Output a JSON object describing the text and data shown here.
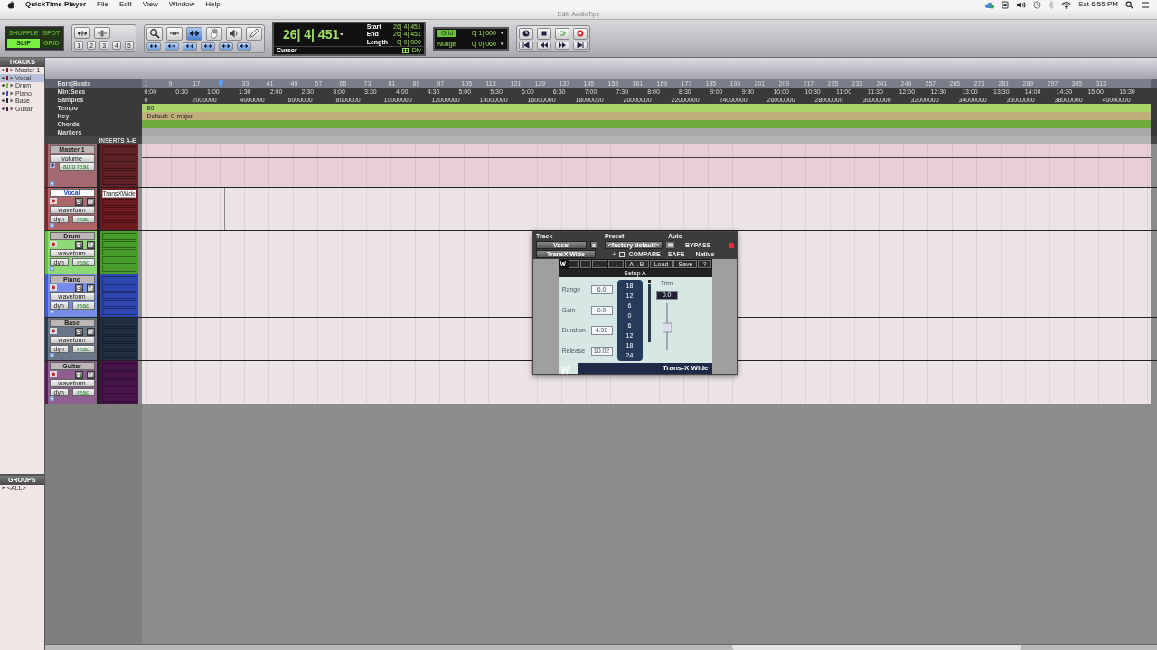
{
  "menubar": {
    "app": "QuickTime Player",
    "menus": [
      "File",
      "Edit",
      "View",
      "Window",
      "Help"
    ],
    "clock": "Sat 6:55 PM"
  },
  "window": {
    "title": "Edit: AudioTipz"
  },
  "edit_modes": [
    {
      "label": "SHUFFLE",
      "selected": false
    },
    {
      "label": "SPOT",
      "selected": false
    },
    {
      "label": "SLIP",
      "selected": true
    },
    {
      "label": "GRID",
      "selected": false
    }
  ],
  "zoom_presets": [
    "1",
    "2",
    "3",
    "4",
    "5"
  ],
  "tools": [
    {
      "kind": "zoom",
      "selected": false
    },
    {
      "kind": "trim",
      "selected": false
    },
    {
      "kind": "selector",
      "selected": true
    },
    {
      "kind": "hand",
      "selected": false
    },
    {
      "kind": "scrub",
      "selected": false
    },
    {
      "kind": "pencil",
      "selected": false
    }
  ],
  "counter": {
    "main": "26| 4| 451",
    "mode": "Cursor",
    "rows": [
      {
        "label": "Start",
        "value": "26| 4| 451"
      },
      {
        "label": "End",
        "value": "26| 4| 451"
      },
      {
        "label": "Length",
        "value": "0| 0| 000"
      }
    ],
    "delay": "Dly"
  },
  "grid": {
    "label": "Grid",
    "value": "0| 1| 000"
  },
  "nudge": {
    "label": "Nudge",
    "value": "0| 0| 060"
  },
  "tracks_panel": {
    "title": "TRACKS",
    "items": [
      {
        "name": "Master 1",
        "color": "#8a1a20",
        "selected": false
      },
      {
        "name": "Vocal",
        "color": "#8a1a20",
        "selected": true
      },
      {
        "name": "Drum",
        "color": "#58d030",
        "selected": false
      },
      {
        "name": "Piano",
        "color": "#3050d8",
        "selected": false
      },
      {
        "name": "Base",
        "color": "#202838",
        "selected": false
      },
      {
        "name": "Guitar",
        "color": "#501050",
        "selected": false
      }
    ]
  },
  "groups_panel": {
    "title": "GROUPS",
    "items": [
      "<ALL>"
    ]
  },
  "rulers": [
    {
      "label": "Bars|Beats",
      "ticks_before_playhead": [
        "1",
        "9",
        "17"
      ],
      "ticks_after_playhead": [
        "33",
        "41",
        "49",
        "57",
        "65",
        "73",
        "81",
        "89",
        "97",
        "105",
        "113",
        "121",
        "129",
        "137",
        "145",
        "153",
        "161",
        "169",
        "177",
        "185",
        "193",
        "201",
        "209",
        "217",
        "225",
        "233",
        "241",
        "249",
        "257",
        "265",
        "273",
        "281",
        "289",
        "297",
        "305",
        "313"
      ]
    },
    {
      "label": "Min:Secs",
      "ticks": [
        "0:00",
        "0:30",
        "1:00",
        "1:30",
        "2:00",
        "2:30",
        "3:00",
        "3:30",
        "4:00",
        "4:30",
        "5:00",
        "5:30",
        "6:00",
        "6:30",
        "7:00",
        "7:30",
        "8:00",
        "8:30",
        "9:00",
        "9:30",
        "10:00",
        "10:30",
        "11:00",
        "11:30",
        "12:00",
        "12:30",
        "13:00",
        "13:30",
        "14:00",
        "14:30",
        "15:00",
        "15:30"
      ]
    },
    {
      "label": "Samples",
      "ticks": [
        "0",
        "2000000",
        "4000000",
        "6000000",
        "8000000",
        "10000000",
        "12000000",
        "14000000",
        "16000000",
        "18000000",
        "20000000",
        "22000000",
        "24000000",
        "26000000",
        "28000000",
        "30000000",
        "32000000",
        "34000000",
        "36000000",
        "38000000",
        "40000000"
      ]
    }
  ],
  "conductor": [
    {
      "label": "Tempo",
      "content": "80",
      "color": "#a8d468"
    },
    {
      "label": "Key",
      "content": "Default: C major",
      "color": "#bfb07a"
    },
    {
      "label": "Chords",
      "color": "#6cab3c"
    },
    {
      "label": "Markers",
      "color": "#a9a9a9"
    }
  ],
  "column_header": "INSERTS A-E",
  "tracks": [
    {
      "name": "Master 1",
      "kind": "master",
      "color": "#7a2a32",
      "selected": false,
      "view": "volume",
      "automation": "auto read"
    },
    {
      "name": "Vocal",
      "kind": "audio",
      "color": "#8a2228",
      "selected": true,
      "solo": "S",
      "mute": "M",
      "view": "waveform",
      "dyn": "dyn",
      "automation": "read",
      "inserts": [
        "TransXWide"
      ]
    },
    {
      "name": "Drum",
      "kind": "audio",
      "color": "#5cc838",
      "selected": false,
      "solo": "S",
      "mute": "M",
      "view": "waveform",
      "dyn": "dyn",
      "automation": "read"
    },
    {
      "name": "Piano",
      "kind": "audio",
      "color": "#3a5ae0",
      "selected": false,
      "solo": "S",
      "mute": "M",
      "view": "waveform",
      "dyn": "dyn",
      "automation": "read"
    },
    {
      "name": "Base",
      "kind": "audio",
      "color": "#2a3c54",
      "selected": false,
      "solo": "S",
      "mute": "M",
      "view": "waveform",
      "dyn": "dyn",
      "automation": "read"
    },
    {
      "name": "Guitar",
      "kind": "audio",
      "color": "#5a1a5e",
      "selected": false,
      "solo": "S",
      "mute": "M",
      "view": "waveform",
      "dyn": "dyn",
      "automation": "read"
    }
  ],
  "plugin": {
    "headings": [
      "Track",
      "Preset",
      "Auto"
    ],
    "track": "Vocal",
    "insert": "a",
    "preset": "<factory default>",
    "bypass": "BYPASS",
    "plugin": "TransX Wide",
    "minus": "-",
    "plus": "+",
    "compare": "COMPARE",
    "safe": "SAFE",
    "format": "Native",
    "toolbar": [
      "←",
      "→",
      "A→B",
      "Load",
      "Save",
      "?"
    ],
    "setup": "Setup A",
    "params": [
      {
        "label": "Range",
        "value": "6.0"
      },
      {
        "label": "Gain",
        "value": "0.0"
      },
      {
        "label": "Duration",
        "value": "4.90"
      },
      {
        "label": "Release",
        "value": "10.02"
      }
    ],
    "scale": [
      "18",
      "12",
      "6",
      "0",
      "6",
      "12",
      "18",
      "24"
    ],
    "trim": {
      "label": "Trim",
      "value": "0.0"
    },
    "title": "Trans-X Wide"
  }
}
